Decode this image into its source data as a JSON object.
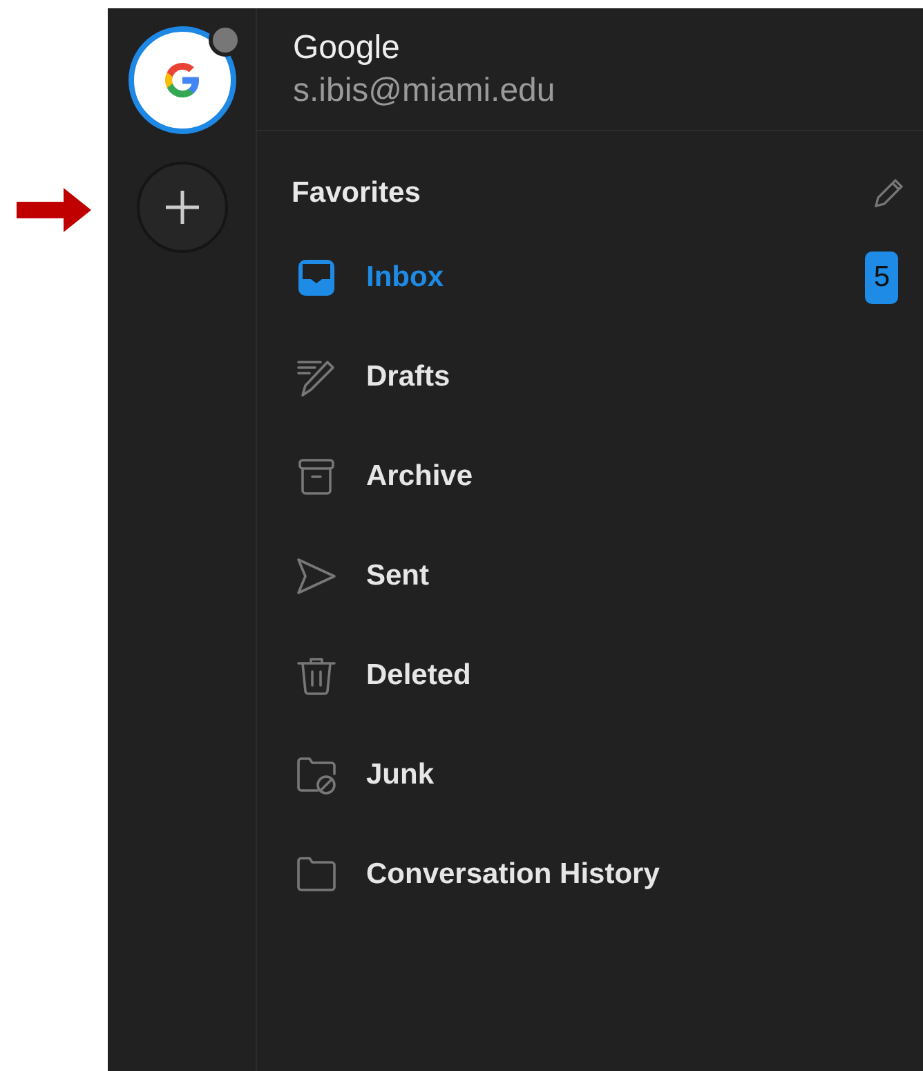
{
  "account": {
    "name": "Google",
    "email": "s.ibis@miami.edu",
    "status_dot": true
  },
  "section": {
    "title": "Favorites"
  },
  "folders": [
    {
      "kind": "inbox",
      "label": "Inbox",
      "selected": true,
      "count": "5"
    },
    {
      "kind": "drafts",
      "label": "Drafts",
      "selected": false
    },
    {
      "kind": "archive",
      "label": "Archive",
      "selected": false
    },
    {
      "kind": "sent",
      "label": "Sent",
      "selected": false
    },
    {
      "kind": "deleted",
      "label": "Deleted",
      "selected": false
    },
    {
      "kind": "junk",
      "label": "Junk",
      "selected": false
    },
    {
      "kind": "folder",
      "label": "Conversation History",
      "selected": false
    }
  ]
}
